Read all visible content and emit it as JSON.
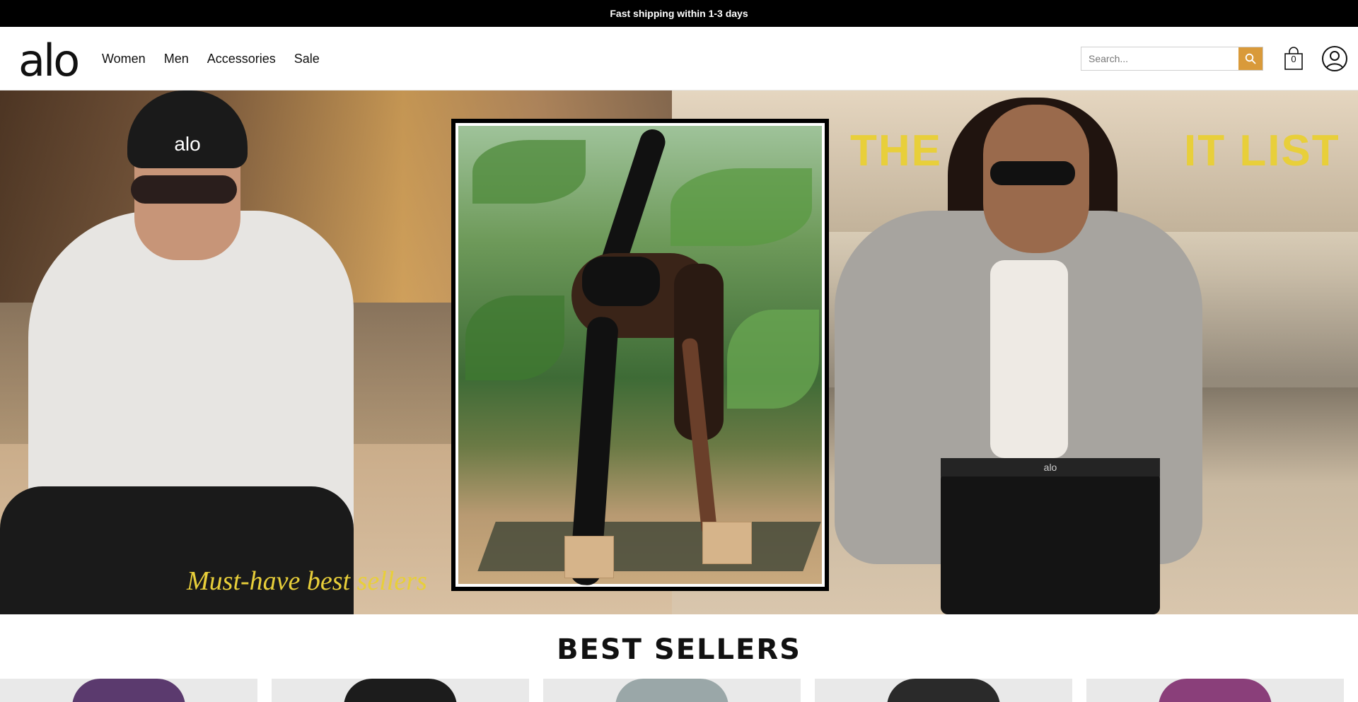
{
  "announcement": "Fast shipping within 1-3 days",
  "header": {
    "logo": "alo",
    "nav": [
      {
        "label": "Women"
      },
      {
        "label": "Men"
      },
      {
        "label": "Accessories"
      },
      {
        "label": "Sale"
      }
    ],
    "search": {
      "placeholder": "Search...",
      "value": ""
    },
    "cart_count": "0"
  },
  "hero": {
    "title_left": "THE",
    "title_right": "IT LIST",
    "subtitle": "Must-have best sellers",
    "hat_logo": "alo",
    "shorts_logo": "alo",
    "accent_color": "#e8cf3a"
  },
  "sections": {
    "best_sellers_title": "BEST SELLERS"
  },
  "products": [
    {
      "name": "product-card-1",
      "color": "#5b3a6e"
    },
    {
      "name": "product-card-2",
      "color": "#1c1c1c"
    },
    {
      "name": "product-card-3",
      "color": "#9aa7a8"
    },
    {
      "name": "product-card-4",
      "color": "#2a2a2a"
    },
    {
      "name": "product-card-5",
      "color": "#8a3f7a"
    }
  ],
  "colors": {
    "announcement_bg": "#000000",
    "search_button": "#d99a3a"
  }
}
